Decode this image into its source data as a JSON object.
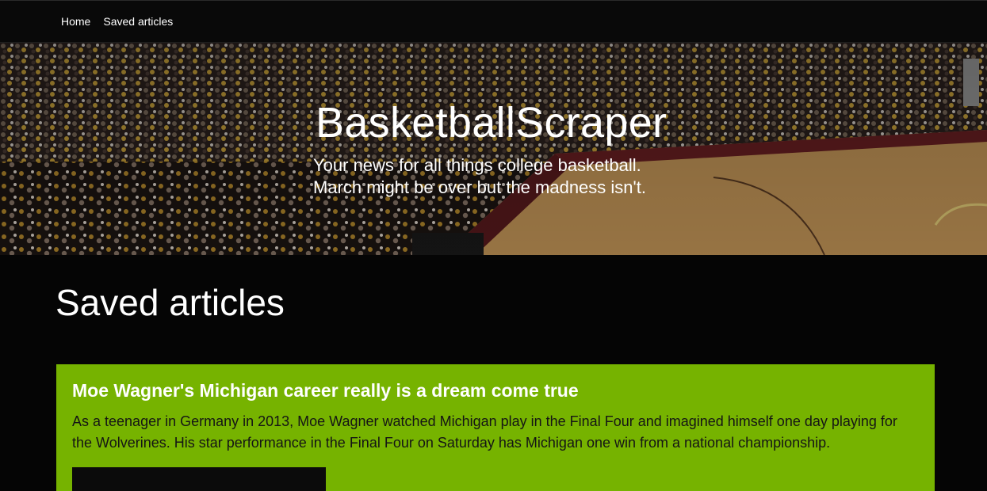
{
  "nav": {
    "links": [
      "Home",
      "Saved articles"
    ]
  },
  "hero": {
    "title": "BasketballScraper",
    "subtitle": "Your news for all things college basketball. March might be over but the madness isn't."
  },
  "page": {
    "heading": "Saved articles"
  },
  "articles": [
    {
      "title": "Moe Wagner's Michigan career really is a dream come true",
      "summary": "As a teenager in Germany in 2013, Moe Wagner watched Michigan play in the Final Four and imagined himself one day playing for the Wolverines. His star performance in the Final Four on Saturday has Michigan one win from a national championship."
    }
  ],
  "colors": {
    "card_bg": "#76b300",
    "page_bg": "#050505",
    "nav_bg": "#090909"
  }
}
